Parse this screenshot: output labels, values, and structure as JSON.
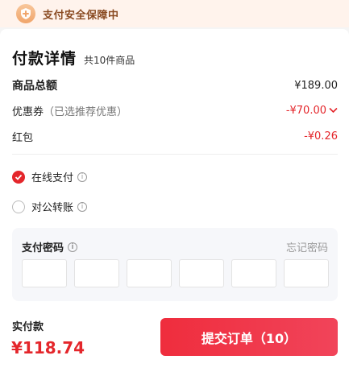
{
  "banner": {
    "text": "支付安全保障中",
    "icon": "shield-plus-icon"
  },
  "detail": {
    "title": "付款详情",
    "item_count": "共10件商品",
    "rows": [
      {
        "label": "商品总额",
        "amount": "¥189.00"
      },
      {
        "label": "优惠券",
        "note": "（已选推荐优惠）",
        "amount": "-¥70.00"
      },
      {
        "label": "红包",
        "amount": "-¥0.26"
      }
    ]
  },
  "payment_options": [
    {
      "label": "在线支付",
      "selected": true
    },
    {
      "label": "对公转账",
      "selected": false
    }
  ],
  "password": {
    "label": "支付密码",
    "forgot": "忘记密码",
    "digits": 6
  },
  "footer": {
    "pay_label": "实付款",
    "pay_amount": "¥118.74",
    "submit_label": "提交订单（10）"
  },
  "colors": {
    "accent": "#e4262b",
    "banner_bg": "#fff3ec",
    "banner_text": "#8a4b22"
  }
}
